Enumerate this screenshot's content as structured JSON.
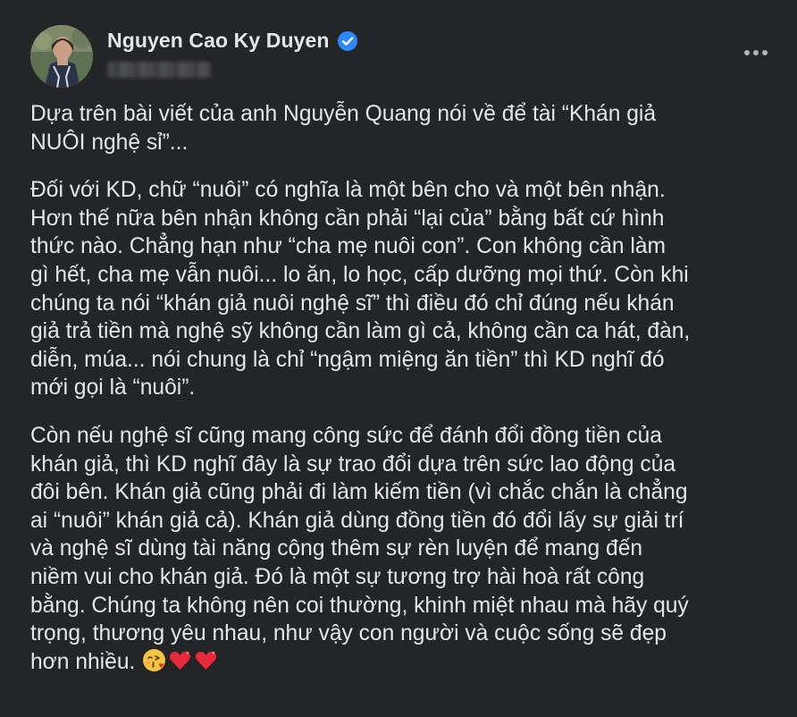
{
  "post": {
    "author": "Nguyen Cao Ky Duyen",
    "verified_icon": "verified-badge-icon",
    "more_icon": "more-options-icon",
    "paragraphs": [
      "Dựa trên bài viết của anh Nguyễn Quang nói về để tài “Khán giả\nNUÔI nghệ sỉ”...",
      "Đối với KD, chữ “nuôi” có nghĩa là một bên cho và một bên nhận.\nHơn thế nữa bên nhận không cần phải “lại của” bằng bất cứ hình\nthức nào.  Chẳng hạn như “cha mẹ nuôi con”.  Con không cần làm\ngì hết, cha mẹ vẫn nuôi... lo ăn, lo học, cấp dưỡng mọi thứ.  Còn khi\nchúng ta nói “khán giả nuôi nghệ sĩ” thì điều đó chỉ đúng nếu khán\ngiả trả tiền mà nghệ sỹ không cần làm gì cả, không cần ca hát, đàn,\ndiễn, múa... nói chung là chỉ “ngậm miệng ăn tiền” thì KD nghĩ đó\nmới gọi là “nuôi”.",
      "Còn nếu nghệ sĩ cũng mang công sức để đánh đổi đồng tiền của\nkhán giả, thì KD nghĩ đây là sự trao đổi dựa trên sức lao động của\nđôi bên. Khán giả cũng phải đi làm kiếm tiền (vì chắc chắn là chẳng\nai “nuôi” khán giả cả). Khán giả dùng đồng tiền đó đổi lấy sự giải trí\nvà nghệ sĩ dùng tài năng cộng thêm sự rèn luyện để mang đến\nniềm vui cho khán giả. Đó là một sự tương trợ hài hoà rất công\nbằng. Chúng ta không nên coi thường, khinh miệt nhau mà hãy quý\ntrọng, thương yêu nhau, như vậy con người và cuộc sống sẽ đẹp\nhơn nhiều."
    ],
    "closing_emojis": [
      "kiss-emoji",
      "heart-emoji",
      "heart-emoji"
    ]
  },
  "colors": {
    "background": "#242526",
    "text": "#e4e6eb",
    "verified": "#2d88ff",
    "icon": "#b0b3b8"
  }
}
